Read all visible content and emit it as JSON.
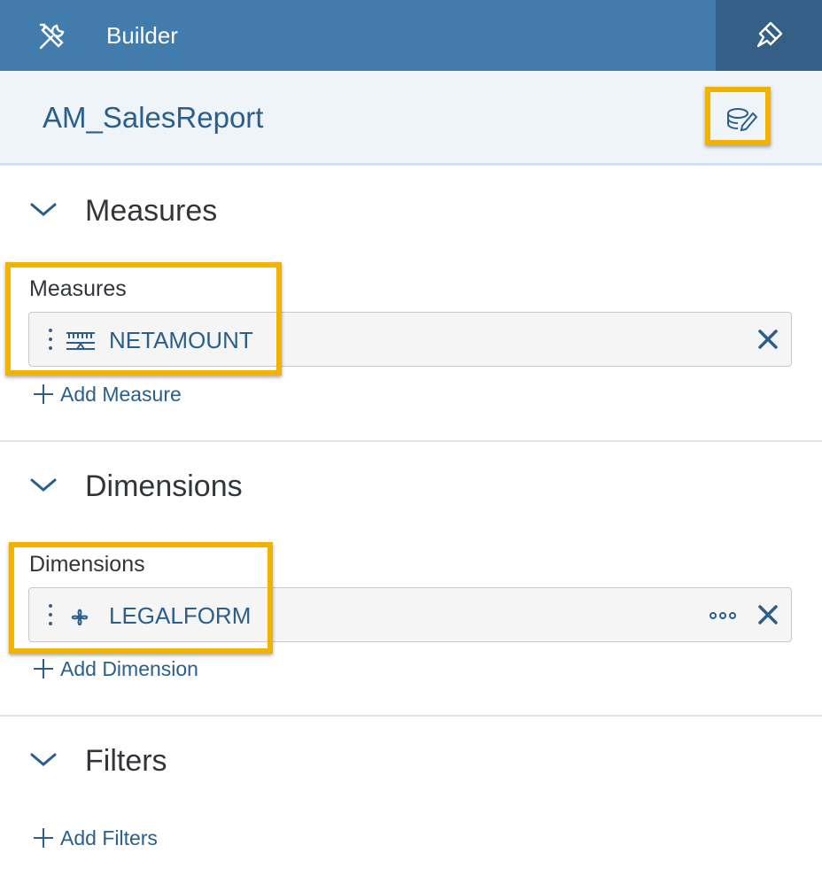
{
  "topbar": {
    "title": "Builder",
    "tool_icon": "wrench-screwdriver-icon",
    "styling_icon": "paint-brush-icon"
  },
  "header": {
    "model_name": "AM_SalesReport",
    "edit_icon": "database-edit-icon"
  },
  "measures": {
    "section_title": "Measures",
    "field_label": "Measures",
    "token": {
      "label": "NETAMOUNT",
      "icon": "measure-ruler-icon"
    },
    "add_label": "Add Measure"
  },
  "dimensions": {
    "section_title": "Dimensions",
    "field_label": "Dimensions",
    "token": {
      "label": "LEGALFORM",
      "icon": "dimension-icon"
    },
    "add_label": "Add Dimension"
  },
  "filters": {
    "section_title": "Filters",
    "add_label": "Add Filters"
  },
  "colors": {
    "topbar": "#427cac",
    "accent_text": "#2a5f8c",
    "highlight": "#f2b300"
  }
}
